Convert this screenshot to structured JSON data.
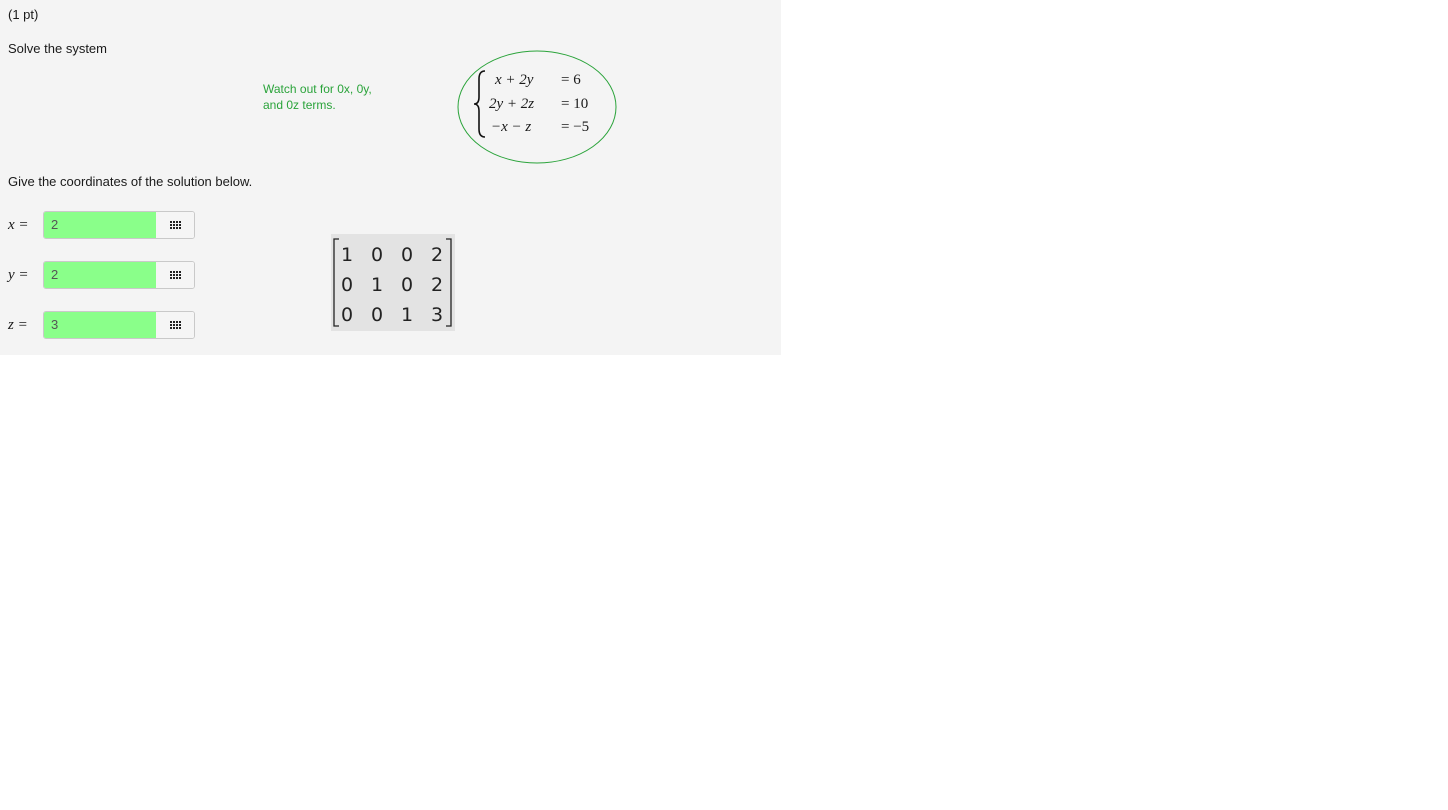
{
  "problem": {
    "points": "(1 pt)",
    "instruction": "Solve the system",
    "note_line1": "Watch out for 0x, 0y,",
    "note_line2": "and 0z terms.",
    "system": {
      "eq1_lhs": "x + 2y",
      "eq1_rhs": "= 6",
      "eq2_lhs": "2y + 2z",
      "eq2_rhs": "= 10",
      "eq3_lhs": "−x − z",
      "eq3_rhs": "= −5"
    },
    "prompt": "Give the coordinates of the solution below.",
    "answers": [
      {
        "label": "x =",
        "value": "2"
      },
      {
        "label": "y =",
        "value": "2"
      },
      {
        "label": "z =",
        "value": "3"
      }
    ],
    "matrix": {
      "rows": [
        [
          "1",
          "0",
          "0",
          "2"
        ],
        [
          "0",
          "1",
          "0",
          "2"
        ],
        [
          "0",
          "0",
          "1",
          "3"
        ]
      ]
    },
    "colors": {
      "note": "#2aa33a",
      "answer_correct": "#8aff8a",
      "panel_bg": "#f4f4f4"
    },
    "icons": {
      "palette": "grid-icon"
    }
  }
}
